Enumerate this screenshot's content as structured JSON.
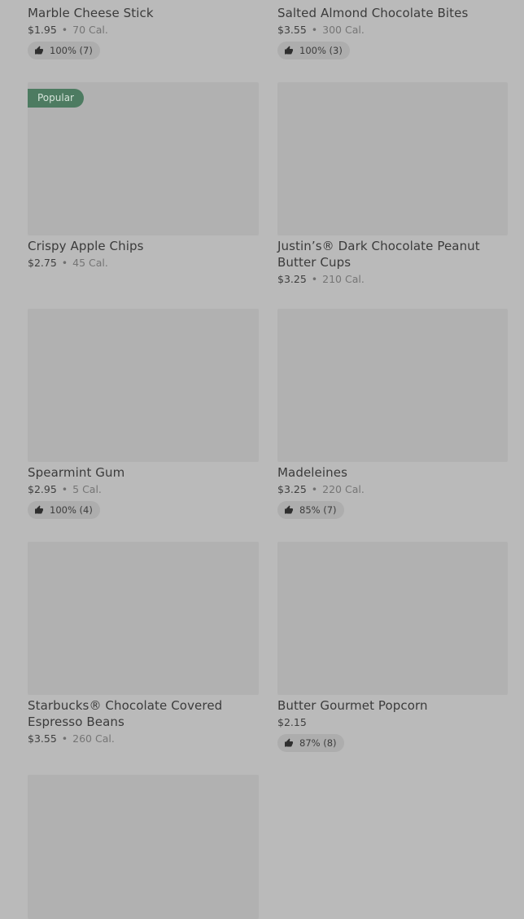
{
  "items": [
    {
      "name": "Marble Cheese Stick",
      "price": "$1.95",
      "cal": "70 Cal.",
      "rating": "100% (7)"
    },
    {
      "name": "Salted Almond Chocolate Bites",
      "price": "$3.55",
      "cal": "300 Cal.",
      "rating": "100% (3)"
    },
    {
      "name": "Crispy Apple Chips",
      "price": "$2.75",
      "cal": "45 Cal.",
      "badge": "Popular"
    },
    {
      "name": "Justin’s® Dark Chocolate Peanut Butter Cups",
      "price": "$3.25",
      "cal": "210 Cal."
    },
    {
      "name": "Spearmint Gum",
      "price": "$2.95",
      "cal": "5 Cal.",
      "rating": "100% (4)"
    },
    {
      "name": "Madeleines",
      "price": "$3.25",
      "cal": "220 Cal.",
      "rating": "85% (7)"
    },
    {
      "name": "Starbucks® Chocolate Covered Espresso Beans",
      "price": "$3.55",
      "cal": "260 Cal."
    },
    {
      "name": "Butter Gourmet Popcorn",
      "price": "$2.15",
      "rating": "87% (8)"
    }
  ],
  "separator": "•"
}
